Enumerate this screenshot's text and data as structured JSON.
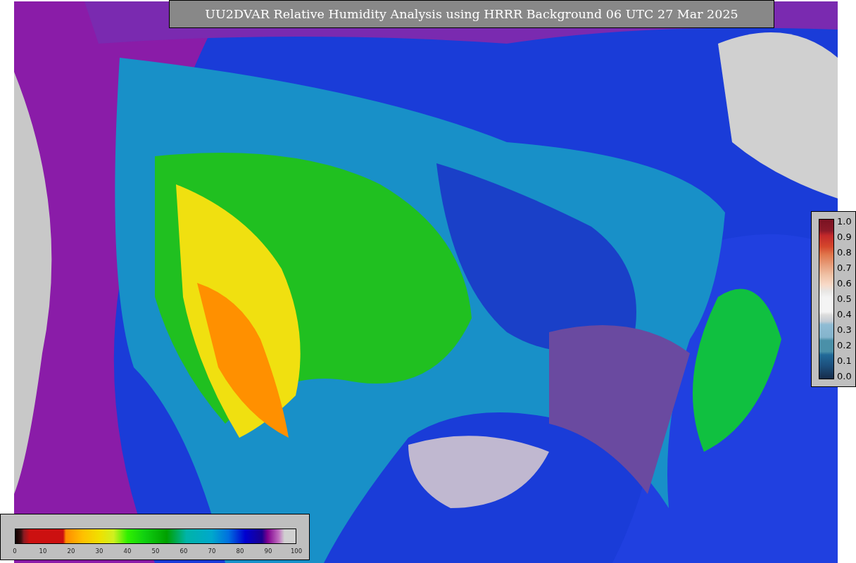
{
  "title": "UU2DVAR Relative Humidity Analysis using HRRR Background 06 UTC 27 Mar 2025",
  "observation_colorbar": {
    "ticks": [
      "1.0",
      "0.9",
      "0.8",
      "0.7",
      "0.6",
      "0.5",
      "0.4",
      "0.3",
      "0.2",
      "0.1",
      "0.0"
    ]
  },
  "humidity_colorbar": {
    "ticks": [
      "0",
      "10",
      "20",
      "30",
      "40",
      "50",
      "60",
      "70",
      "80",
      "90",
      "100"
    ]
  }
}
